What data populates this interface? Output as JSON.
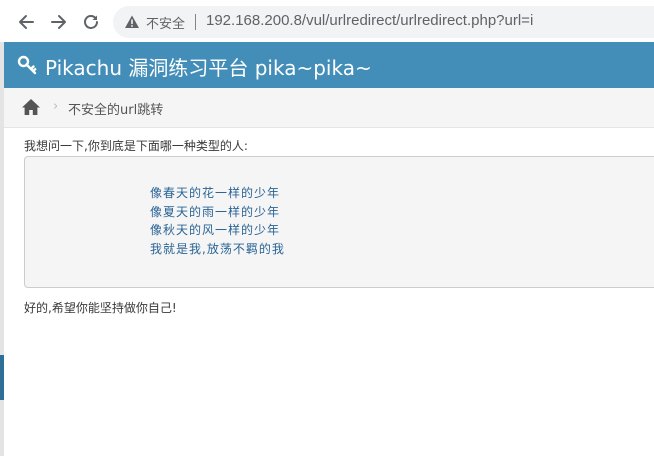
{
  "browser": {
    "security_label": "不安全",
    "url": "192.168.200.8/vul/urlredirect/urlredirect.php?url=i"
  },
  "app": {
    "title": "Pikachu 漏洞练习平台 pika~pika~"
  },
  "breadcrumb": {
    "separator": "›",
    "current": "不安全的url跳转"
  },
  "content": {
    "question": "我想问一下,你到底是下面哪一种类型的人:",
    "options": [
      "像春天的花一样的少年",
      "像夏天的雨一样的少年",
      "像秋天的风一样的少年",
      "我就是我,放荡不羁的我"
    ],
    "answer": "好的,希望你能坚持做你自己!"
  },
  "colors": {
    "header_bg": "#438eb9",
    "link": "#2a6496",
    "breadcrumb_bg": "#f5f5f5"
  },
  "icons": [
    "back-arrow-icon",
    "forward-arrow-icon",
    "reload-icon",
    "warning-triangle-icon",
    "key-icon",
    "home-icon"
  ]
}
